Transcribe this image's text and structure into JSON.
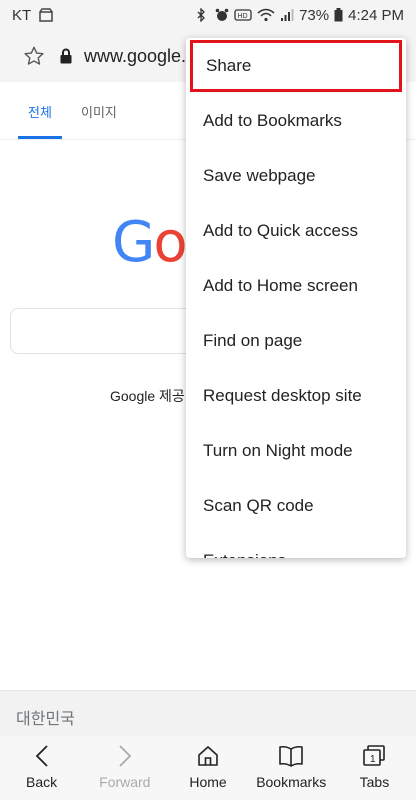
{
  "status_bar": {
    "carrier": "KT",
    "battery": "73%",
    "time": "4:24 PM"
  },
  "url_bar": {
    "url": "www.google."
  },
  "page": {
    "tabs": [
      {
        "label": "전체",
        "active": true
      },
      {
        "label": "이미지",
        "active": false
      }
    ],
    "logo_text_a": "G",
    "logo_text_b": "o",
    "offered_text": "Google 제공",
    "country": "대한민국"
  },
  "menu": {
    "items": [
      {
        "label": "Share",
        "highlighted": true
      },
      {
        "label": "Add to Bookmarks"
      },
      {
        "label": "Save webpage"
      },
      {
        "label": "Add to Quick access"
      },
      {
        "label": "Add to Home screen"
      },
      {
        "label": "Find on page"
      },
      {
        "label": "Request desktop site"
      },
      {
        "label": "Turn on Night mode"
      },
      {
        "label": "Scan QR code"
      },
      {
        "label": "Extensions"
      }
    ],
    "highlight_color": "#e1141a"
  },
  "bottom_bar": {
    "items": [
      {
        "label": "Back",
        "icon": "chevron-left-icon",
        "enabled": true
      },
      {
        "label": "Forward",
        "icon": "chevron-right-icon",
        "enabled": false
      },
      {
        "label": "Home",
        "icon": "home-icon",
        "enabled": true
      },
      {
        "label": "Bookmarks",
        "icon": "book-icon",
        "enabled": true
      },
      {
        "label": "Tabs",
        "icon": "tabs-icon",
        "enabled": true,
        "count": "1"
      }
    ]
  },
  "colors": {
    "accent": "#1a73e8",
    "google_blue": "#4285f4",
    "google_red": "#ea4335"
  }
}
